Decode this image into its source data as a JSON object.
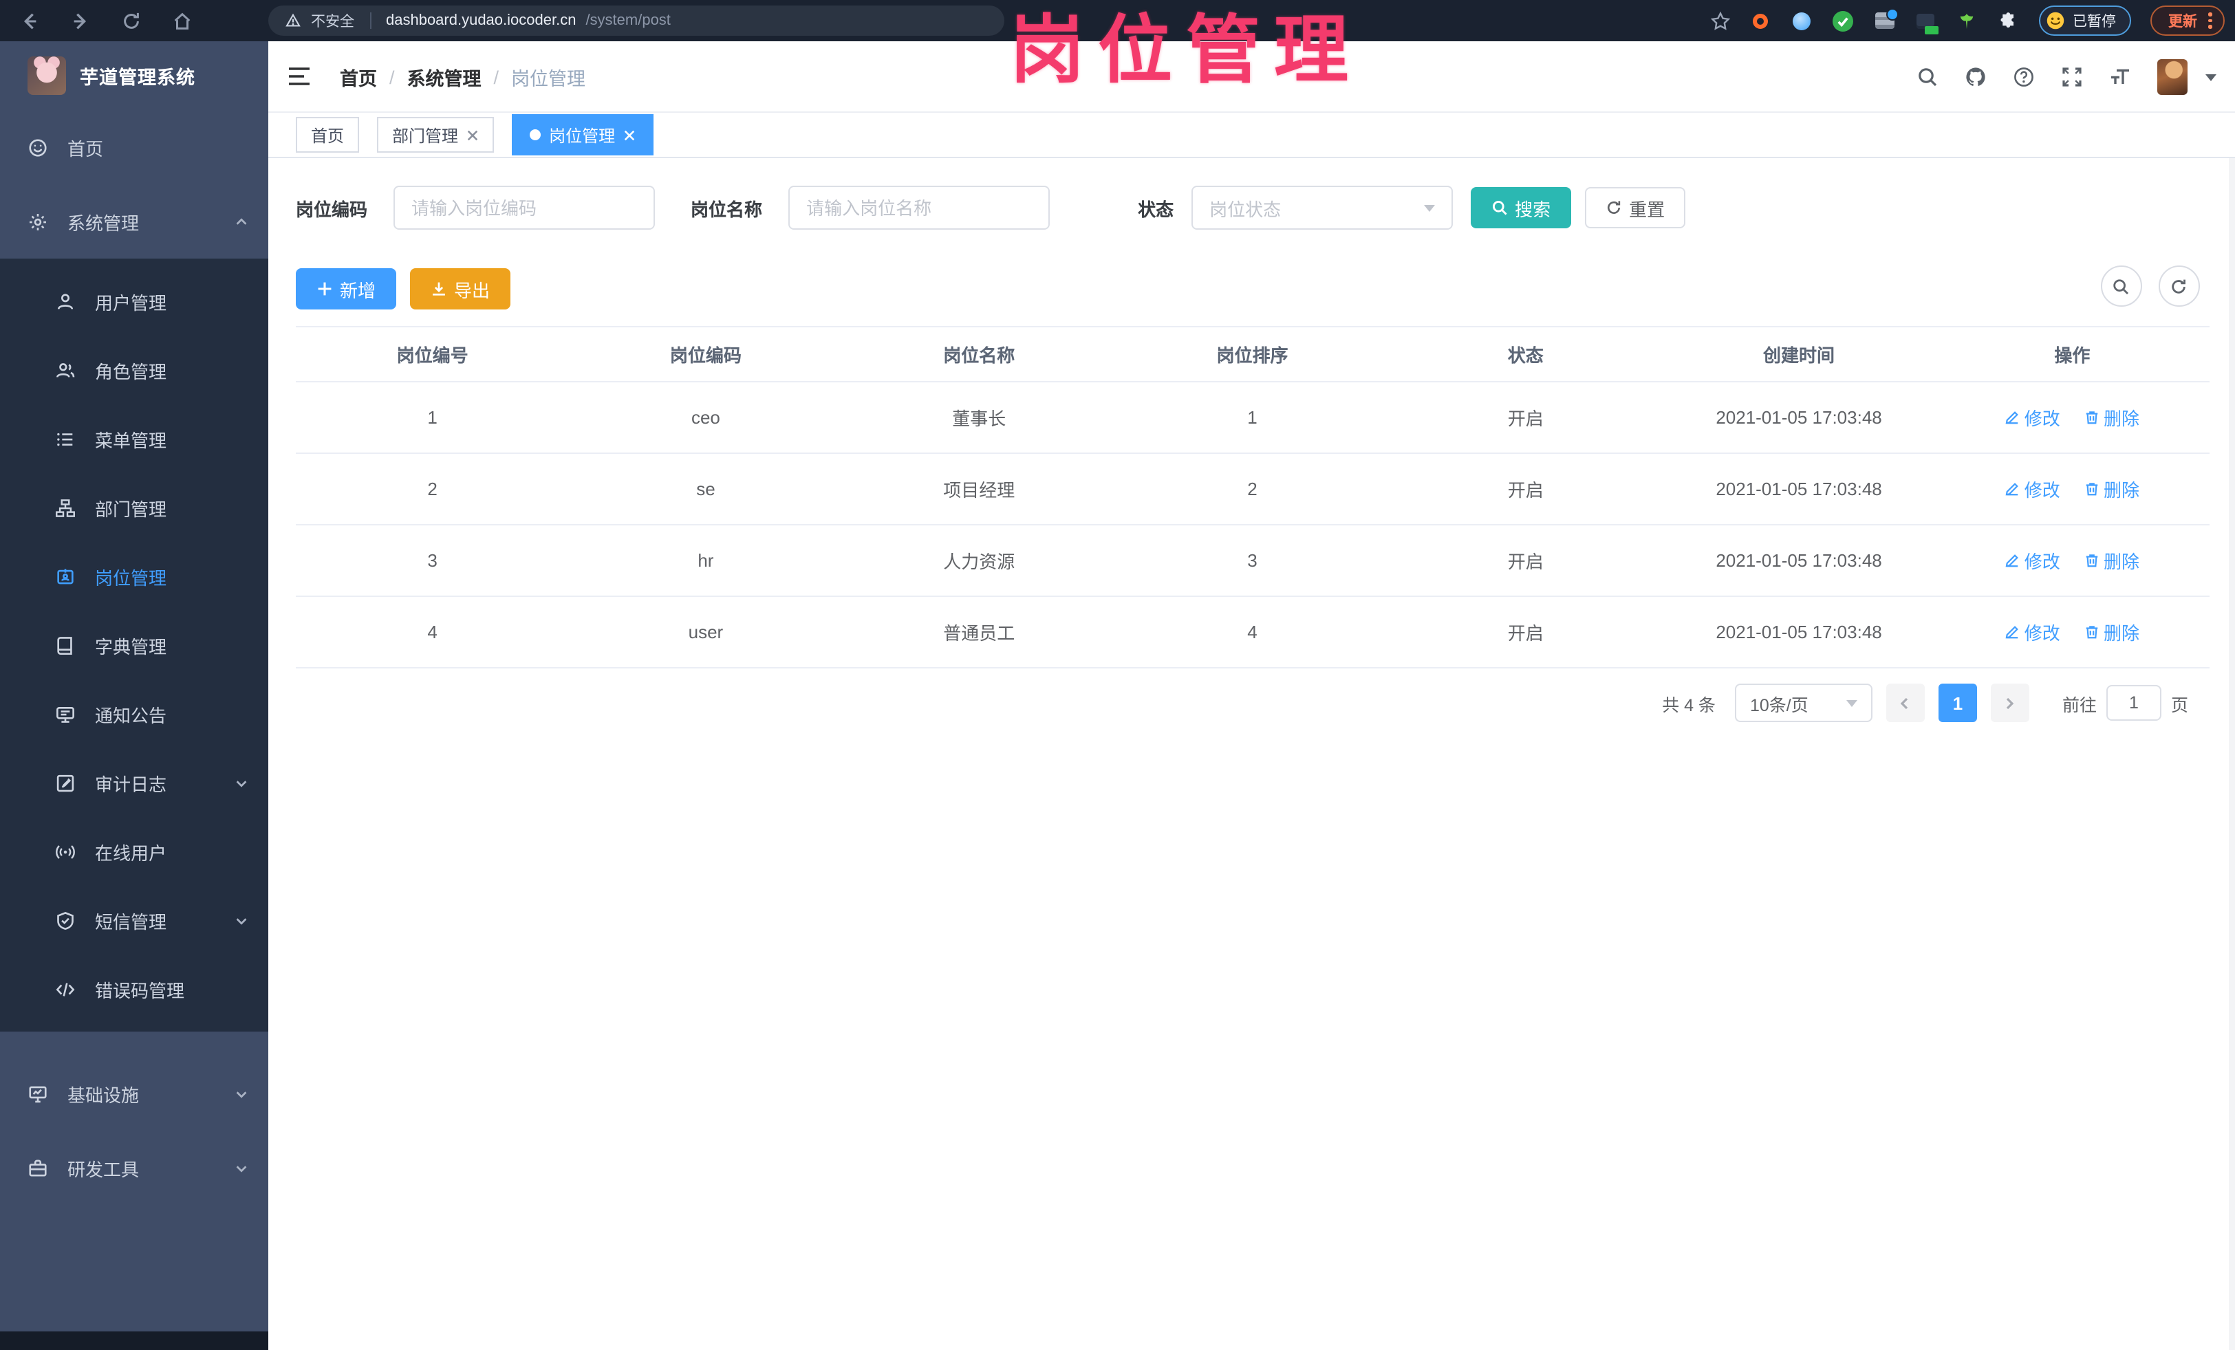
{
  "overlay_title": "岗位管理",
  "colors": {
    "accent": "#409eff",
    "teal": "#2bb8b2",
    "warning": "#eea21d",
    "annotation_pink": "#f43b6c",
    "sidebar_bg": "#3f4c67",
    "sidebar_submenu_bg": "#232e40",
    "topbar_bg": "#1a2230"
  },
  "browser": {
    "security_label": "不安全",
    "url_domain": "dashboard.yudao.iocoder.cn",
    "url_path": "/system/post",
    "paused_badge": "已暂停",
    "update_label": "更新",
    "left_icons": [
      "back-icon",
      "forward-icon",
      "reload-icon",
      "home-icon"
    ],
    "right_icons": [
      "bookmark-star-icon",
      "extension-donut-icon",
      "extension-drop-icon",
      "extension-check-icon",
      "extension-bars-icon",
      "extension-gtm-icon",
      "extension-sprout-icon",
      "extensions-puzzle-icon",
      "profile-paused-badge",
      "update-button",
      "kebab-menu-icon"
    ]
  },
  "sidebar": {
    "app_title": "芋道管理系统",
    "items": [
      {
        "label": "首页",
        "icon": "home-icon"
      },
      {
        "label": "系统管理",
        "icon": "gear-icon",
        "chevron": "up"
      },
      {
        "label": "用户管理",
        "icon": "user-icon"
      },
      {
        "label": "角色管理",
        "icon": "role-icon"
      },
      {
        "label": "菜单管理",
        "icon": "menu-list-icon"
      },
      {
        "label": "部门管理",
        "icon": "org-tree-icon"
      },
      {
        "label": "岗位管理",
        "icon": "badge-icon",
        "active": true
      },
      {
        "label": "字典管理",
        "icon": "dictionary-icon"
      },
      {
        "label": "通知公告",
        "icon": "announcement-icon"
      },
      {
        "label": "审计日志",
        "icon": "audit-log-icon",
        "chevron": "down"
      },
      {
        "label": "在线用户",
        "icon": "online-user-icon"
      },
      {
        "label": "短信管理",
        "icon": "sms-icon",
        "chevron": "down"
      },
      {
        "label": "错误码管理",
        "icon": "error-code-icon"
      },
      {
        "label": "基础设施",
        "icon": "infrastructure-icon",
        "chevron": "down"
      },
      {
        "label": "研发工具",
        "icon": "dev-tools-icon",
        "chevron": "down"
      }
    ]
  },
  "header": {
    "breadcrumb": [
      "首页",
      "系统管理",
      "岗位管理"
    ],
    "breadcrumb_separator": "/",
    "right_icons": [
      "search-icon",
      "github-icon",
      "help-icon",
      "fullscreen-icon",
      "font-size-icon",
      "avatar",
      "chevron-down-icon"
    ]
  },
  "tabs": [
    {
      "label": "首页"
    },
    {
      "label": "部门管理"
    },
    {
      "label": "岗位管理"
    }
  ],
  "search": {
    "fields": [
      {
        "label": "岗位编码",
        "placeholder": "请输入岗位编码"
      },
      {
        "label": "岗位名称",
        "placeholder": "请输入岗位名称"
      },
      {
        "label": "状态",
        "placeholder": "岗位状态"
      }
    ],
    "search_label": "搜索",
    "reset_label": "重置"
  },
  "toolbar": {
    "add_label": "新增",
    "export_label": "导出",
    "right_icons": [
      "search-toggle-icon",
      "refresh-icon"
    ]
  },
  "table": {
    "headers": [
      "岗位编号",
      "岗位编码",
      "岗位名称",
      "岗位排序",
      "状态",
      "创建时间",
      "操作"
    ],
    "edit_label": "修改",
    "delete_label": "删除",
    "rows": [
      {
        "id": "1",
        "code": "ceo",
        "name": "董事长",
        "sort": "1",
        "status": "开启",
        "created": "2021-01-05 17:03:48"
      },
      {
        "id": "2",
        "code": "se",
        "name": "项目经理",
        "sort": "2",
        "status": "开启",
        "created": "2021-01-05 17:03:48"
      },
      {
        "id": "3",
        "code": "hr",
        "name": "人力资源",
        "sort": "3",
        "status": "开启",
        "created": "2021-01-05 17:03:48"
      },
      {
        "id": "4",
        "code": "user",
        "name": "普通员工",
        "sort": "4",
        "status": "开启",
        "created": "2021-01-05 17:03:48"
      }
    ]
  },
  "pagination": {
    "total": "共 4 条",
    "page_size": "10条/页",
    "current_page": "1",
    "goto_label": "前往",
    "goto_value": "1",
    "page_unit": "页"
  }
}
